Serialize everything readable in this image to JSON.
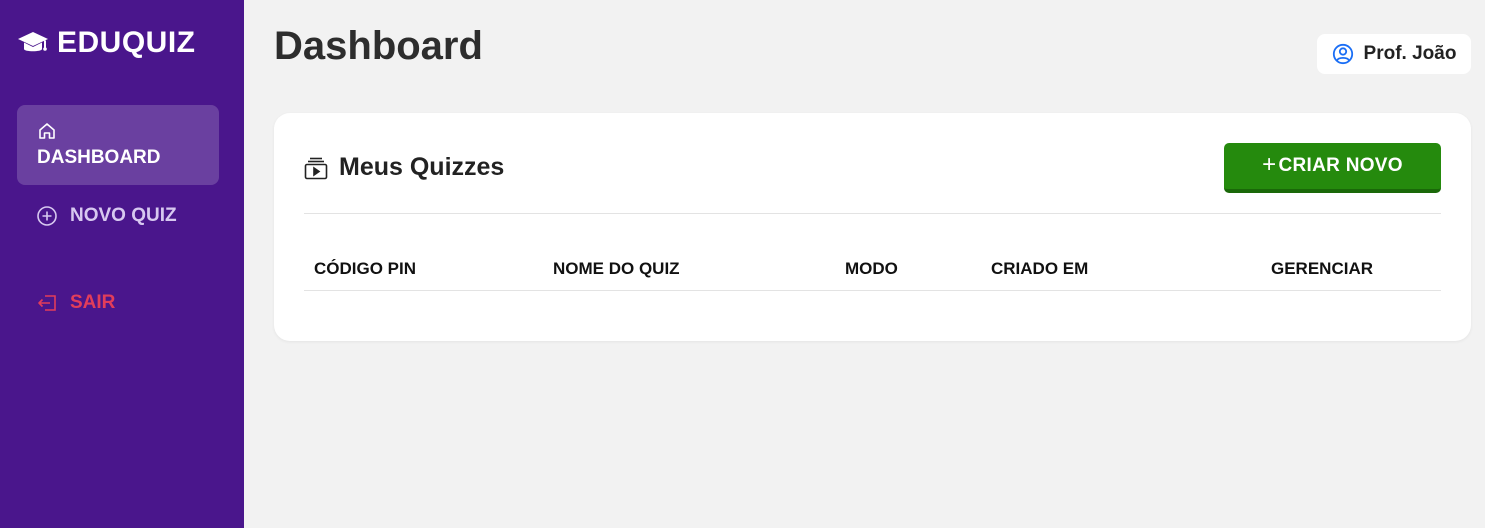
{
  "brand": {
    "name": "EDUQUIZ",
    "icon": "graduation-cap-icon"
  },
  "sidebar": {
    "items": [
      {
        "label": "DASHBOARD",
        "icon": "home-icon",
        "active": true
      },
      {
        "label": "NOVO QUIZ",
        "icon": "plus-circle-icon",
        "active": false
      },
      {
        "label": "SAIR",
        "icon": "logout-icon",
        "active": false
      }
    ]
  },
  "header": {
    "title": "Dashboard",
    "user": {
      "name": "Prof. João",
      "icon": "user-circle-icon"
    }
  },
  "quizzes": {
    "title": "Meus Quizzes",
    "icon": "collection-play-icon",
    "create_button": {
      "plus": "+",
      "label": "CRIAR NOVO"
    },
    "columns": [
      "CÓDIGO PIN",
      "NOME DO QUIZ",
      "MODO",
      "CRIADO EM",
      "GERENCIAR"
    ],
    "rows": []
  },
  "colors": {
    "sidebar_bg": "#4a168c",
    "accent_green": "#258a0d",
    "logout_red": "#e23d5a",
    "page_bg": "#f2f2f2"
  }
}
